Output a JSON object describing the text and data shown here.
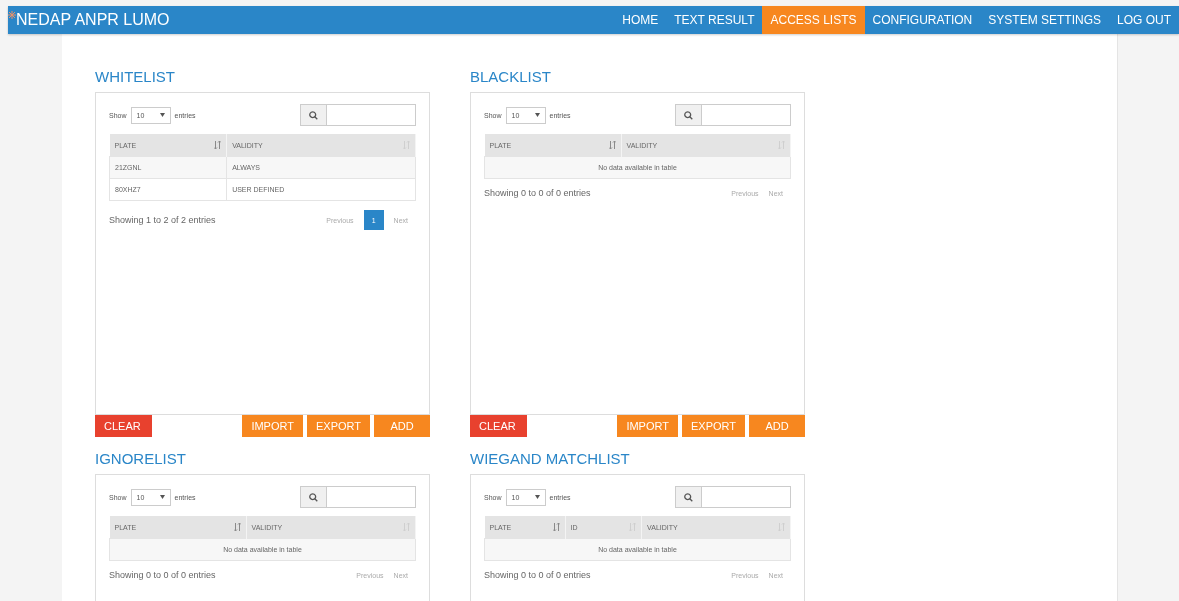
{
  "navbar": {
    "brand": "NEDAP ANPR LUMO",
    "items": [
      {
        "label": "HOME",
        "selected": false
      },
      {
        "label": "TEXT RESULT",
        "selected": false
      },
      {
        "label": "ACCESS LISTS",
        "selected": true
      },
      {
        "label": "CONFIGURATION",
        "selected": false
      },
      {
        "label": "SYSTEM SETTINGS",
        "selected": false
      },
      {
        "label": "LOG OUT",
        "selected": false
      }
    ]
  },
  "lists": [
    {
      "title": "WHITELIST",
      "show_label": "Show",
      "length": "10",
      "entries_label": "entries",
      "columns": [
        {
          "label": "PLATE",
          "sorted": true
        },
        {
          "label": "VALIDITY",
          "sorted": false
        }
      ],
      "rows": [
        [
          "21ZGNL",
          "ALWAYS"
        ],
        [
          "80XHZ7",
          "USER DEFINED"
        ]
      ],
      "info": "Showing 1 to 2 of 2 entries",
      "previous": "Previous",
      "pages": [
        {
          "label": "1",
          "selected": true
        }
      ],
      "next": "Next",
      "buttons": [
        {
          "label": "CLEAR",
          "kind": "danger"
        },
        {
          "label": "IMPORT",
          "kind": "normal"
        },
        {
          "label": "EXPORT",
          "kind": "normal"
        },
        {
          "label": "ADD",
          "kind": "normal"
        }
      ]
    },
    {
      "title": "BLACKLIST",
      "show_label": "Show",
      "length": "10",
      "entries_label": "entries",
      "columns": [
        {
          "label": "PLATE",
          "sorted": true
        },
        {
          "label": "VALIDITY",
          "sorted": false
        }
      ],
      "empty_message": "No data available in table",
      "info": "Showing 0 to 0 of 0 entries",
      "previous": "Previous",
      "next": "Next",
      "buttons": [
        {
          "label": "CLEAR",
          "kind": "danger"
        },
        {
          "label": "IMPORT",
          "kind": "normal"
        },
        {
          "label": "EXPORT",
          "kind": "normal"
        },
        {
          "label": "ADD",
          "kind": "normal"
        }
      ]
    },
    {
      "title": "IGNORELIST",
      "show_label": "Show",
      "length": "10",
      "entries_label": "entries",
      "columns": [
        {
          "label": "PLATE",
          "sorted": true
        },
        {
          "label": "VALIDITY",
          "sorted": false
        }
      ],
      "empty_message": "No data available in table",
      "info": "Showing 0 to 0 of 0 entries",
      "previous": "Previous",
      "next": "Next"
    },
    {
      "title": "WIEGAND MATCHLIST",
      "show_label": "Show",
      "length": "10",
      "entries_label": "entries",
      "columns": [
        {
          "label": "PLATE",
          "sorted": true
        },
        {
          "label": "ID",
          "sorted": false
        },
        {
          "label": "VALIDITY",
          "sorted": false
        }
      ],
      "empty_message": "No data available in table",
      "info": "Showing 0 to 0 of 0 entries",
      "previous": "Previous",
      "next": "Next"
    }
  ]
}
